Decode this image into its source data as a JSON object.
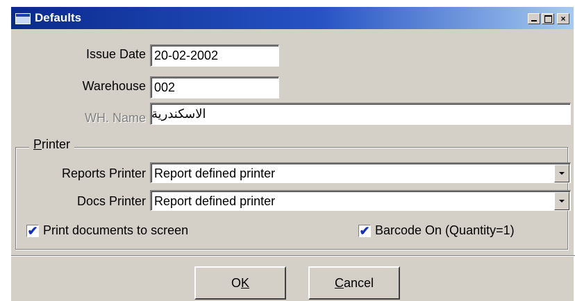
{
  "window": {
    "title": "Defaults",
    "close_glyph": "×"
  },
  "fields": {
    "issue_date": {
      "label": "Issue Date",
      "value": "20-02-2002"
    },
    "warehouse": {
      "label": "Warehouse",
      "value": "002"
    },
    "wh_name": {
      "label": "WH. Name",
      "value": "الاسكندرية"
    }
  },
  "printer": {
    "group_label_hotkey": "P",
    "group_label_rest": "rinter",
    "reports_printer": {
      "label": "Reports Printer",
      "value": "Report defined printer"
    },
    "docs_printer": {
      "label": "Docs Printer",
      "value": "Report defined printer"
    },
    "print_to_screen": {
      "label": "Print documents to screen",
      "checked": true,
      "mark": "✔"
    },
    "barcode_on": {
      "label": "Barcode On (Quantity=1)",
      "checked": true,
      "mark": "✔"
    }
  },
  "buttons": {
    "ok_prefix": "O",
    "ok_hotkey": "K",
    "cancel_hotkey": "C",
    "cancel_rest": "ancel"
  },
  "icons": {
    "window": "window-icon",
    "minimize": "minimize-icon",
    "maximize": "maximize-icon",
    "close": "close-icon",
    "dropdown": "chevron-down-icon",
    "check": "checkmark-icon"
  }
}
